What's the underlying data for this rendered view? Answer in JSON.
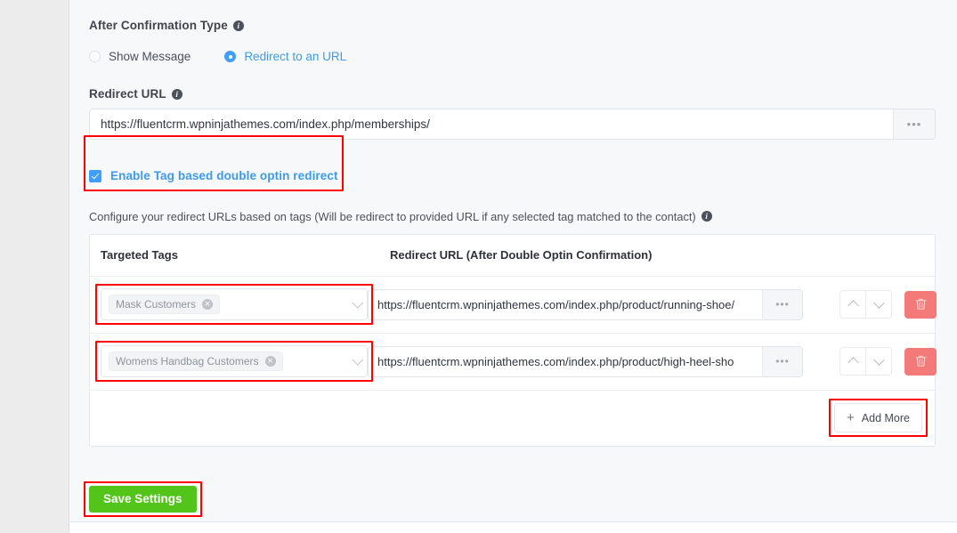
{
  "form": {
    "confirmation_type_label": "After Confirmation Type",
    "info_icon": "info-icon",
    "options": [
      {
        "label": "Show Message",
        "selected": false
      },
      {
        "label": "Redirect to an URL",
        "selected": true
      }
    ],
    "redirect_url_label": "Redirect URL",
    "redirect_url_value": "https://fluentcrm.wpninjathemes.com/index.php/memberships/",
    "redirect_url_placeholder": "https://",
    "append_icon": "ellipsis-icon",
    "enable_tag_redirect": {
      "label": "Enable Tag based double optin redirect",
      "checked": true,
      "highlighted": true
    },
    "hint": "Configure your redirect URLs based on tags (Will be redirect to provided URL if any selected tag matched to the contact)"
  },
  "table": {
    "headers": {
      "tags": "Targeted Tags",
      "url": "Redirect URL (After Double Optin Confirmation)"
    },
    "rows": [
      {
        "tag": "Mask Customers",
        "tag_remove_icon": "close-circle-icon",
        "tag_caret_icon": "chevron-down-icon",
        "tag_highlighted": true,
        "url": "https://fluentcrm.wpninjathemes.com/index.php/product/running-shoe/",
        "url_placeholder": "https://",
        "append_icon": "ellipsis-icon",
        "move_up_icon": "chevron-up-icon",
        "move_down_icon": "chevron-down-icon",
        "delete_icon": "trash-icon"
      },
      {
        "tag": "Womens Handbag Customers",
        "tag_remove_icon": "close-circle-icon",
        "tag_caret_icon": "chevron-down-icon",
        "tag_highlighted": true,
        "url": "https://fluentcrm.wpninjathemes.com/index.php/product/high-heel-sho",
        "url_placeholder": "https://",
        "append_icon": "ellipsis-icon",
        "move_up_icon": "chevron-up-icon",
        "move_down_icon": "chevron-down-icon",
        "delete_icon": "trash-icon"
      }
    ],
    "add_more_label": "Add More",
    "add_more_icon": "plus-icon",
    "add_more_highlighted": true
  },
  "footer": {
    "save_label": "Save Settings",
    "save_highlighted": true
  },
  "colors": {
    "accent_blue": "#409eff",
    "link_blue": "#3b9bf0",
    "highlight_red": "#ff0000",
    "save_green": "#52c41a",
    "delete_red": "#f47a7a",
    "panel_bg": "#f7f8fa",
    "gutter_gray": "#ececec"
  }
}
